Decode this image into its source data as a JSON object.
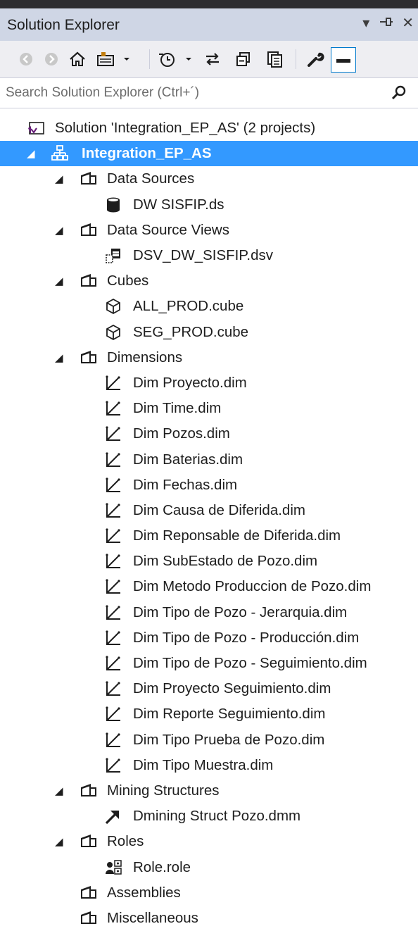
{
  "panel": {
    "title": "Solution Explorer",
    "pin_glyph": "▾",
    "autohide_glyph": "⊣",
    "close_glyph": "✕"
  },
  "toolbar": {
    "back_icon": "back-icon",
    "forward_icon": "forward-icon",
    "home_icon": "home-icon",
    "switch_views_icon": "switch-views-icon",
    "pending_changes_icon": "pending-changes-icon",
    "sync_icon": "sync-icon",
    "collapse_all_icon": "collapse-all-icon",
    "show_all_files_icon": "show-all-files-icon",
    "properties_icon": "wrench-icon",
    "preview_icon": "preview-icon"
  },
  "search": {
    "placeholder": "Search Solution Explorer (Ctrl+´)"
  },
  "tree": {
    "solution": "Solution 'Integration_EP_AS' (2 projects)",
    "project": "Integration_EP_AS",
    "data_sources": {
      "label": "Data Sources",
      "items": [
        "DW SISFIP.ds"
      ]
    },
    "data_source_views": {
      "label": "Data Source Views",
      "items": [
        "DSV_DW_SISFIP.dsv"
      ]
    },
    "cubes": {
      "label": "Cubes",
      "items": [
        "ALL_PROD.cube",
        "SEG_PROD.cube"
      ]
    },
    "dimensions": {
      "label": "Dimensions",
      "items": [
        "Dim Proyecto.dim",
        "Dim Time.dim",
        "Dim Pozos.dim",
        "Dim Baterias.dim",
        "Dim Fechas.dim",
        "Dim Causa de Diferida.dim",
        "Dim Reponsable de Diferida.dim",
        "Dim SubEstado de Pozo.dim",
        "Dim Metodo Produccion de Pozo.dim",
        "Dim Tipo de Pozo - Jerarquia.dim",
        "Dim Tipo de Pozo - Producción.dim",
        "Dim Tipo de Pozo - Seguimiento.dim",
        "Dim Proyecto Seguimiento.dim",
        "Dim Reporte Seguimiento.dim",
        "Dim Tipo Prueba de Pozo.dim",
        "Dim Tipo Muestra.dim"
      ]
    },
    "mining_structures": {
      "label": "Mining Structures",
      "items": [
        "Dmining Struct Pozo.dmm"
      ]
    },
    "roles": {
      "label": "Roles",
      "items": [
        "Role.role"
      ]
    },
    "assemblies": {
      "label": "Assemblies"
    },
    "miscellaneous": {
      "label": "Miscellaneous"
    },
    "expanded_glyph": "◢"
  }
}
